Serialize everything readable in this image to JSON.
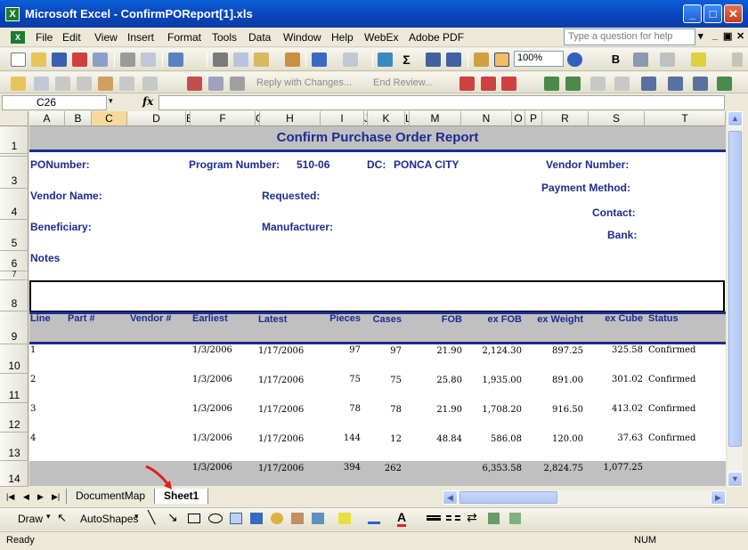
{
  "window": {
    "title": "Microsoft Excel - ConfirmPOReport[1].xls",
    "app_icon": "X"
  },
  "menu": [
    "File",
    "Edit",
    "View",
    "Insert",
    "Format",
    "Tools",
    "Data",
    "Window",
    "Help",
    "WebEx",
    "Adobe PDF"
  ],
  "help_placeholder": "Type a question for help",
  "toolbar": {
    "zoom": "100%",
    "reply_changes": "Reply with Changes...",
    "end_review": "End Review..."
  },
  "name_box": "C26",
  "fx": "fx",
  "columns": [
    "A",
    "B",
    "C",
    "D",
    "E",
    "F",
    "G",
    "H",
    "I",
    "J",
    "K",
    "L",
    "M",
    "N",
    "O",
    "P",
    "R",
    "S",
    "T"
  ],
  "rows": [
    "1",
    "3",
    "4",
    "5",
    "6",
    "7",
    "8",
    "9",
    "10",
    "11",
    "12",
    "13",
    "14"
  ],
  "report": {
    "title": "Confirm Purchase Order Report",
    "po_number": "PONumber:",
    "program_number_label": "Program Number:",
    "program_number": "510-06",
    "dc_label": "DC:",
    "dc": "PONCA CITY",
    "vendor_number": "Vendor Number:",
    "vendor_name": "Vendor Name:",
    "requested": "Requested:",
    "payment_method": "Payment Method:",
    "contact": "Contact:",
    "beneficiary": "Beneficiary:",
    "manufacturer": "Manufacturer:",
    "bank": "Bank:",
    "notes": "Notes"
  },
  "table": {
    "headers": [
      "Line",
      "Part #",
      "Vendor #",
      "Earliest",
      "Latest",
      "Pieces",
      "Cases",
      "FOB",
      "ex FOB",
      "ex Weight",
      "ex Cube",
      "Status"
    ],
    "rows": [
      [
        "1",
        "1/3/2006",
        "1/17/2006",
        "97",
        "97",
        "21.90",
        "2,124.30",
        "897.25",
        "325.58",
        "Confirmed"
      ],
      [
        "2",
        "1/3/2006",
        "1/17/2006",
        "75",
        "75",
        "25.80",
        "1,935.00",
        "891.00",
        "301.02",
        "Confirmed"
      ],
      [
        "3",
        "1/3/2006",
        "1/17/2006",
        "78",
        "78",
        "21.90",
        "1,708.20",
        "916.50",
        "413.02",
        "Confirmed"
      ],
      [
        "4",
        "1/3/2006",
        "1/17/2006",
        "144",
        "12",
        "48.84",
        "586.08",
        "120.00",
        "37.63",
        "Confirmed"
      ]
    ],
    "totals": [
      "1/3/2006",
      "1/17/2006",
      "394",
      "262",
      "6,353.58",
      "2,824.75",
      "1,077.25"
    ]
  },
  "sheet_tabs": [
    "DocumentMap",
    "Sheet1"
  ],
  "active_tab": "Sheet1",
  "drawbar": {
    "draw": "Draw",
    "autoshapes": "AutoShapes"
  },
  "status": {
    "ready": "Ready",
    "num": "NUM"
  },
  "colors": {
    "accent": "#1c2c8f",
    "header_fill": "#c0c0c0",
    "titlebar": "#0842b8"
  }
}
